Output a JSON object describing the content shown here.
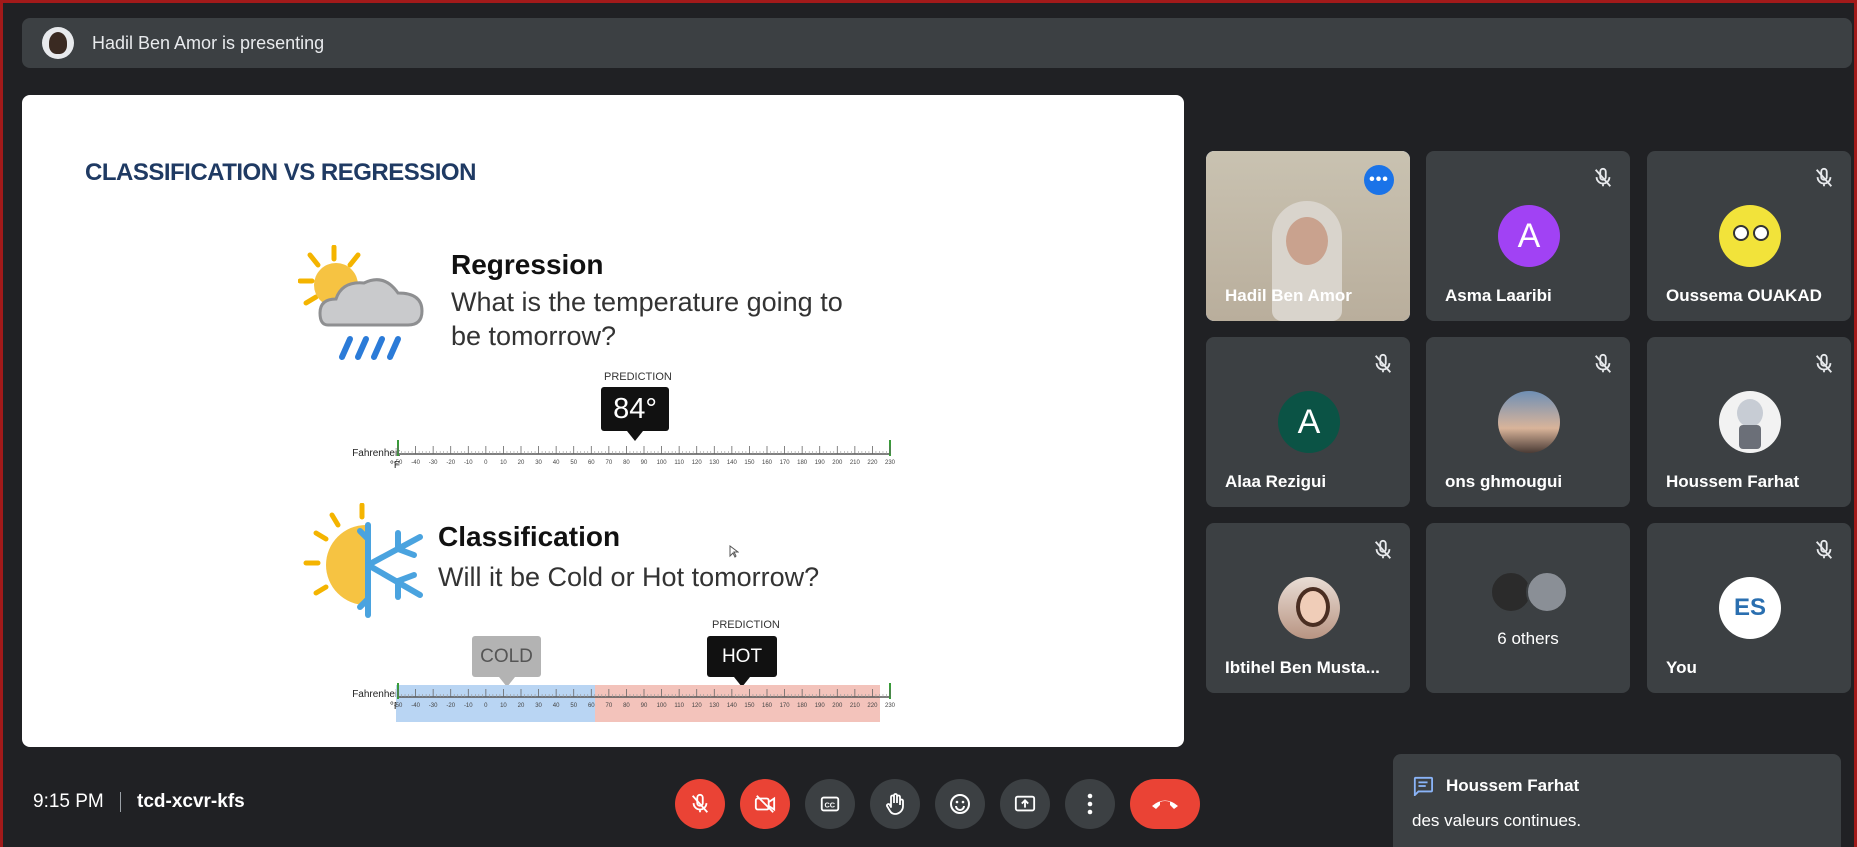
{
  "presenter_bar": {
    "text": "Hadil Ben Amor is presenting"
  },
  "slide": {
    "title": "CLASSIFICATION VS REGRESSION",
    "regression": {
      "heading": "Regression",
      "question_line1": "What is the temperature going to",
      "question_line2": "be tomorrow?",
      "prediction_label": "PREDICTION",
      "prediction_value": "84°"
    },
    "classification": {
      "heading": "Classification",
      "question": "Will it be Cold or Hot tomorrow?",
      "prediction_label": "PREDICTION",
      "cold_label": "COLD",
      "hot_label": "HOT"
    },
    "scale": {
      "label_line1": "Fahrenheit",
      "label_line2": "°F",
      "ticks": [
        "-50",
        "-40",
        "-30",
        "-20",
        "-10",
        "0",
        "10",
        "20",
        "30",
        "40",
        "50",
        "60",
        "70",
        "80",
        "90",
        "100",
        "110",
        "120",
        "130",
        "140",
        "150",
        "160",
        "170",
        "180",
        "190",
        "200",
        "210",
        "220",
        "230"
      ]
    }
  },
  "participants": [
    {
      "name": "Hadil Ben Amor",
      "type": "video",
      "muted": false,
      "active": true
    },
    {
      "name": "Asma Laaribi",
      "type": "letter",
      "letter": "A",
      "color": "#a142f4",
      "muted": true
    },
    {
      "name": "Oussema OUAKAD",
      "type": "sponge",
      "muted": true
    },
    {
      "name": "Alaa Rezigui",
      "type": "letter",
      "letter": "A",
      "color": "#0b5345",
      "muted": true
    },
    {
      "name": "ons ghmougui",
      "type": "photo",
      "muted": true
    },
    {
      "name": "Houssem Farhat",
      "type": "figure",
      "muted": true
    },
    {
      "name": "Ibtihel Ben Musta...",
      "type": "photo2",
      "muted": true
    },
    {
      "name": "6 others",
      "type": "others",
      "muted": false
    },
    {
      "name": "You",
      "type": "es",
      "badge": "ES",
      "muted": true
    }
  ],
  "bottom_bar": {
    "time": "9:15 PM",
    "meeting_code": "tcd-xcvr-kfs"
  },
  "chat_toast": {
    "sender": "Houssem Farhat",
    "message": "des valeurs continues."
  },
  "colors": {
    "background": "#202124",
    "tile": "#3c4043",
    "danger": "#ea4335",
    "accent": "#8ab4f8"
  }
}
